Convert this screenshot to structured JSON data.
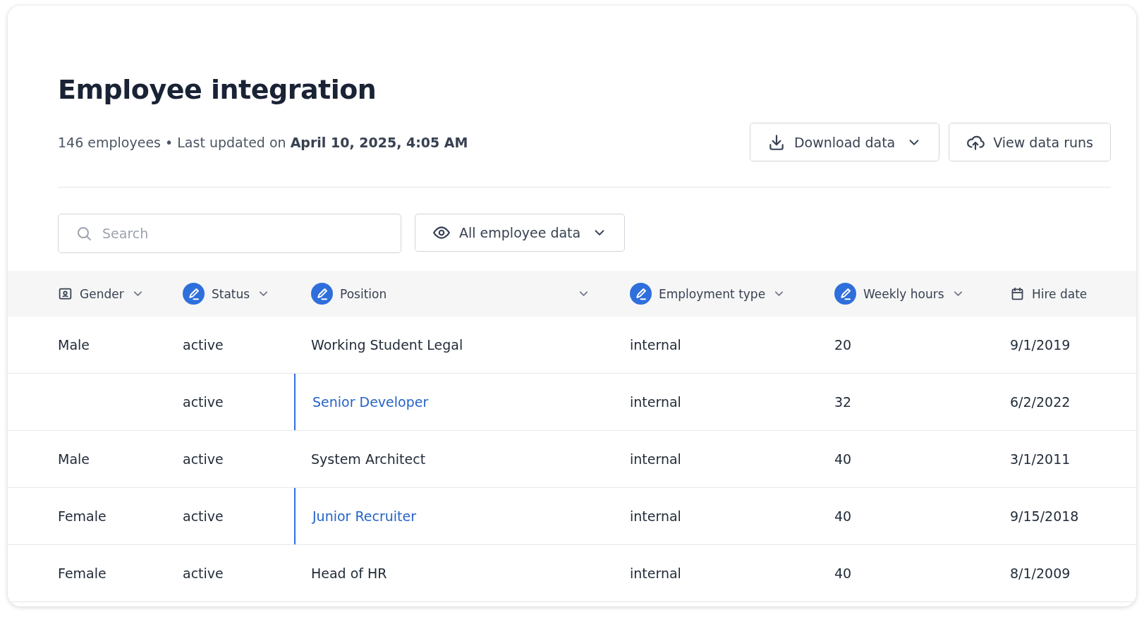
{
  "page": {
    "title": "Employee integration",
    "subtitle": "146 employees • Last updated on **April 10, 2025, 4:05 AM**"
  },
  "actions": [
    {
      "label": "Download data",
      "menu": true
    },
    {
      "label": "View data runs",
      "menu": false
    }
  ],
  "search": {
    "placeholder": "Search"
  },
  "view_filter": {
    "label": "All employee data",
    "menu": true
  },
  "table": {
    "columns": [
      {
        "label": "Gender",
        "kind": "profile",
        "menu": true
      },
      {
        "label": "Status",
        "kind": "editable",
        "menu": true
      },
      {
        "label": "Position",
        "kind": "editable",
        "menu": true
      },
      {
        "label": "Employment type",
        "kind": "editable",
        "menu": true
      },
      {
        "label": "Weekly hours",
        "kind": "editable",
        "menu": true
      },
      {
        "label": "Hire date",
        "kind": "date",
        "menu": false
      }
    ],
    "rows": [
      {
        "cells": [
          {
            "text": "Male",
            "edited": false
          },
          {
            "text": "active",
            "edited": false
          },
          {
            "text": "Working Student Legal",
            "edited": false
          },
          {
            "text": "internal",
            "edited": false
          },
          {
            "text": "20",
            "edited": false
          },
          {
            "text": "9/1/2019",
            "edited": false
          }
        ]
      },
      {
        "cells": [
          {
            "text": "",
            "edited": false
          },
          {
            "text": "active",
            "edited": false
          },
          {
            "text": "Senior Developer",
            "edited": true
          },
          {
            "text": "internal",
            "edited": false
          },
          {
            "text": "32",
            "edited": false
          },
          {
            "text": "6/2/2022",
            "edited": false
          }
        ]
      },
      {
        "cells": [
          {
            "text": "Male",
            "edited": false
          },
          {
            "text": "active",
            "edited": false
          },
          {
            "text": "System Architect",
            "edited": false
          },
          {
            "text": "internal",
            "edited": false
          },
          {
            "text": "40",
            "edited": false
          },
          {
            "text": "3/1/2011",
            "edited": false
          }
        ]
      },
      {
        "cells": [
          {
            "text": "Female",
            "edited": false
          },
          {
            "text": "active",
            "edited": false
          },
          {
            "text": "Junior Recruiter",
            "edited": true
          },
          {
            "text": "internal",
            "edited": false
          },
          {
            "text": "40",
            "edited": false
          },
          {
            "text": "9/15/2018",
            "edited": false
          }
        ]
      },
      {
        "cells": [
          {
            "text": "Female",
            "edited": false
          },
          {
            "text": "active",
            "edited": false
          },
          {
            "text": "Head of HR",
            "edited": false
          },
          {
            "text": "internal",
            "edited": false
          },
          {
            "text": "40",
            "edited": false
          },
          {
            "text": "8/1/2009",
            "edited": false
          }
        ]
      }
    ]
  }
}
